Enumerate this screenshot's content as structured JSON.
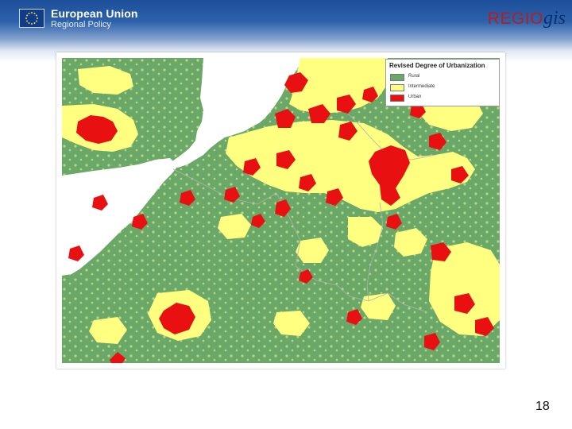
{
  "header": {
    "org_line1": "European Union",
    "org_line2": "Regional Policy",
    "brand_regio": "REGIO",
    "brand_gis": "gis"
  },
  "colors": {
    "rural": "#6aa86a",
    "intermediate": "#ffff80",
    "urban": "#e81010",
    "sea": "#ffffff",
    "border": "#b0b0b0"
  },
  "map": {
    "legend": {
      "title": "Revised Degree of Urbanization",
      "items": [
        {
          "label": "Rural",
          "color": "#6aa86a"
        },
        {
          "label": "Intermediate",
          "color": "#ffff80"
        },
        {
          "label": "Urban",
          "color": "#e81010"
        }
      ]
    }
  },
  "page_number": "18"
}
